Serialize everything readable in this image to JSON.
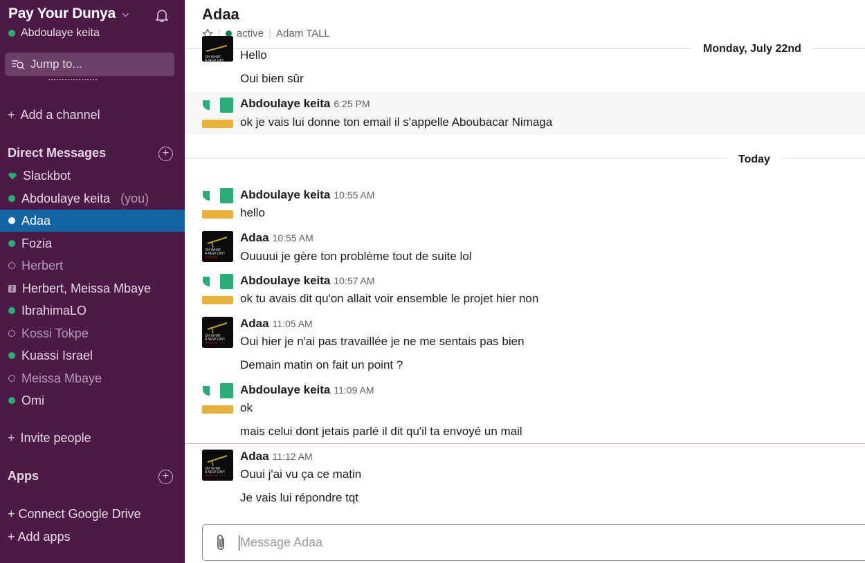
{
  "workspace": {
    "name": "Pay Your Dunya",
    "user": "Abdoulaye keita"
  },
  "search": {
    "placeholder": "Jump to..."
  },
  "sidebar": {
    "add_channel": "Add a channel",
    "dm_header": "Direct Messages",
    "dms": [
      {
        "name": "Slackbot",
        "status": "bot"
      },
      {
        "name": "Abdoulaye keita",
        "suffix": "(you)",
        "status": "online"
      },
      {
        "name": "Adaa",
        "status": "online",
        "selected": true
      },
      {
        "name": "Fozia",
        "status": "online"
      },
      {
        "name": "Herbert",
        "status": "away"
      },
      {
        "name": "Herbert, Meissa Mbaye",
        "status": "group",
        "badge": "2"
      },
      {
        "name": "IbrahimaLO",
        "status": "online"
      },
      {
        "name": "Kossi Tokpe",
        "status": "away"
      },
      {
        "name": "Kuassi Israel",
        "status": "online"
      },
      {
        "name": "Meissa Mbaye",
        "status": "away"
      },
      {
        "name": "Omi",
        "status": "online"
      }
    ],
    "invite": "Invite people",
    "apps_header": "Apps",
    "connect_drive": "+ Connect Google Drive",
    "add_apps": "+ Add apps"
  },
  "channel": {
    "title": "Adaa",
    "presence": "active",
    "full_name": "Adam TALL"
  },
  "days": {
    "previous": "Monday, July 22nd",
    "today": "Today"
  },
  "messages": {
    "m0": {
      "lines": [
        "Hello",
        "Oui bien sûr"
      ]
    },
    "m1": {
      "author": "Abdoulaye keita",
      "time": "6:25 PM",
      "lines": [
        "ok je vais lui donne ton email il s'appelle Aboubacar Nimaga"
      ]
    },
    "m2": {
      "author": "Abdoulaye keita",
      "time": "10:55 AM",
      "lines": [
        "hello"
      ]
    },
    "m3": {
      "author": "Adaa",
      "time": "10:55 AM",
      "lines": [
        "Ouuuui je gère ton problème tout de suite lol"
      ]
    },
    "m4": {
      "author": "Abdoulaye keita",
      "time": "10:57 AM",
      "lines": [
        "ok tu avais dit qu'on allait voir ensemble le projet hier non"
      ]
    },
    "m5": {
      "author": "Adaa",
      "time": "11:05 AM",
      "lines": [
        "Oui hier je n'ai pas travaillée je ne me sentais pas bien",
        "Demain matin on fait un point ?"
      ]
    },
    "m6": {
      "author": "Abdoulaye keita",
      "time": "11:09 AM",
      "lines": [
        "ok",
        "mais celui dont jetais parlé il dit qu'il ta envoyé un mail"
      ]
    },
    "m7": {
      "author": "Adaa",
      "time": "11:12 AM",
      "lines": [
        "Ouui j'ai vu ça ce matin",
        "Je vais lui répondre tqt"
      ]
    }
  },
  "composer": {
    "placeholder": "Message Adaa"
  },
  "colors": {
    "sidebar": "#4d1a48",
    "selected": "#1264a3",
    "online": "#2bac76",
    "avatar_green": "#2bac76",
    "avatar_yellow": "#e8b13c"
  },
  "icons": [
    "bell-icon",
    "search-icon",
    "star-icon",
    "paperclip-icon",
    "heart-icon",
    "add-circle-icon"
  ]
}
